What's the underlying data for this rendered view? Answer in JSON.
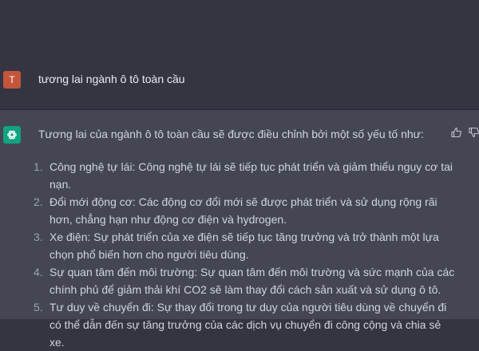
{
  "user_message": {
    "avatar_letter": "T",
    "text": "tương lai ngành ô tô toàn cầu"
  },
  "assistant_message": {
    "intro": "Tương lai của ngành ô tô toàn cầu sẽ được điều chỉnh bởi một số yếu tố như:",
    "points": [
      {
        "number": "1.",
        "text": "Công nghệ tự lái: Công nghệ tự lái sẽ tiếp tục phát triển và giảm thiểu nguy cơ tai nạn."
      },
      {
        "number": "2.",
        "text": "Đổi mới động cơ: Các động cơ đổi mới sẽ được phát triển và sử dụng rộng rãi hơn, chẳng hạn như động cơ điện và hydrogen."
      },
      {
        "number": "3.",
        "text": "Xe điện: Sự phát triển của xe điện sẽ tiếp tục tăng trưởng và trở thành một lựa chọn phổ biến hơn cho người tiêu dùng."
      },
      {
        "number": "4.",
        "text": "Sự quan tâm đến môi trường: Sự quan tâm đến môi trường và sức mạnh của các chính phủ để giảm thải khí CO2 sẽ làm thay đổi cách sản xuất và sử dụng ô tô."
      },
      {
        "number": "5.",
        "text": "Tư duy về chuyển đi: Sự thay đổi trong tư duy của người tiêu dùng về chuyển đi có thể dẫn đến sự tăng trưởng của các dịch vụ chuyển đi công cộng và chia sẻ xe."
      }
    ]
  },
  "icons": {
    "bot_avatar": "openai-logo-icon",
    "feedback_up": "thumbs-up-icon",
    "feedback_down": "thumbs-down-icon"
  },
  "colors": {
    "background": "#343541",
    "assistant_background": "#444654",
    "user_avatar": "#c4553a",
    "bot_avatar": "#10a37f"
  }
}
